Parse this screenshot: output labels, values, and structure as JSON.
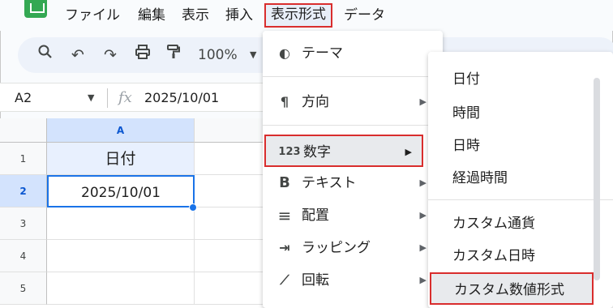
{
  "menubar": {
    "items": [
      {
        "label": "ファイル"
      },
      {
        "label": "編集"
      },
      {
        "label": "表示"
      },
      {
        "label": "挿入"
      },
      {
        "label": "表示形式"
      },
      {
        "label": "データ"
      }
    ]
  },
  "toolbar": {
    "zoom": "100%",
    "icons": [
      "search-icon",
      "undo-icon",
      "redo-icon",
      "print-icon",
      "paint-format-icon"
    ]
  },
  "formula_bar": {
    "cell_ref": "A2",
    "fx": "fx",
    "value": "2025/10/01"
  },
  "grid": {
    "column_header": "A",
    "rows": [
      {
        "num": "1",
        "a": "日付"
      },
      {
        "num": "2",
        "a": "2025/10/01"
      },
      {
        "num": "3",
        "a": ""
      },
      {
        "num": "4",
        "a": ""
      },
      {
        "num": "5",
        "a": ""
      }
    ]
  },
  "format_menu": {
    "items": [
      {
        "icon": "palette-icon",
        "glyph": "◐",
        "label": "テーマ"
      },
      {
        "icon": "direction-icon",
        "glyph": "¶",
        "label": "方向",
        "arrow": "▶"
      },
      {
        "icon": "number-icon",
        "glyph": "123",
        "label": "数字",
        "arrow": "▶"
      },
      {
        "icon": "bold-icon",
        "glyph": "B",
        "label": "テキスト",
        "arrow": "▶"
      },
      {
        "icon": "align-icon",
        "glyph": "≡",
        "label": "配置",
        "arrow": "▶"
      },
      {
        "icon": "wrap-icon",
        "glyph": "⇥",
        "label": "ラッピング",
        "arrow": "▶"
      },
      {
        "icon": "rotate-icon",
        "glyph": "⟋",
        "label": "回転",
        "arrow": "▶"
      }
    ]
  },
  "number_submenu": {
    "items": [
      {
        "label": "日付"
      },
      {
        "label": "時間"
      },
      {
        "label": "日時"
      },
      {
        "label": "経過時間"
      },
      {
        "label": "カスタム通貨"
      },
      {
        "label": "カスタム日時"
      },
      {
        "label": "カスタム数値形式"
      }
    ]
  },
  "colors": {
    "highlight_border": "#d92d2d",
    "selection_blue": "#1a73e8",
    "toolbar_bg": "#edf2fa"
  }
}
